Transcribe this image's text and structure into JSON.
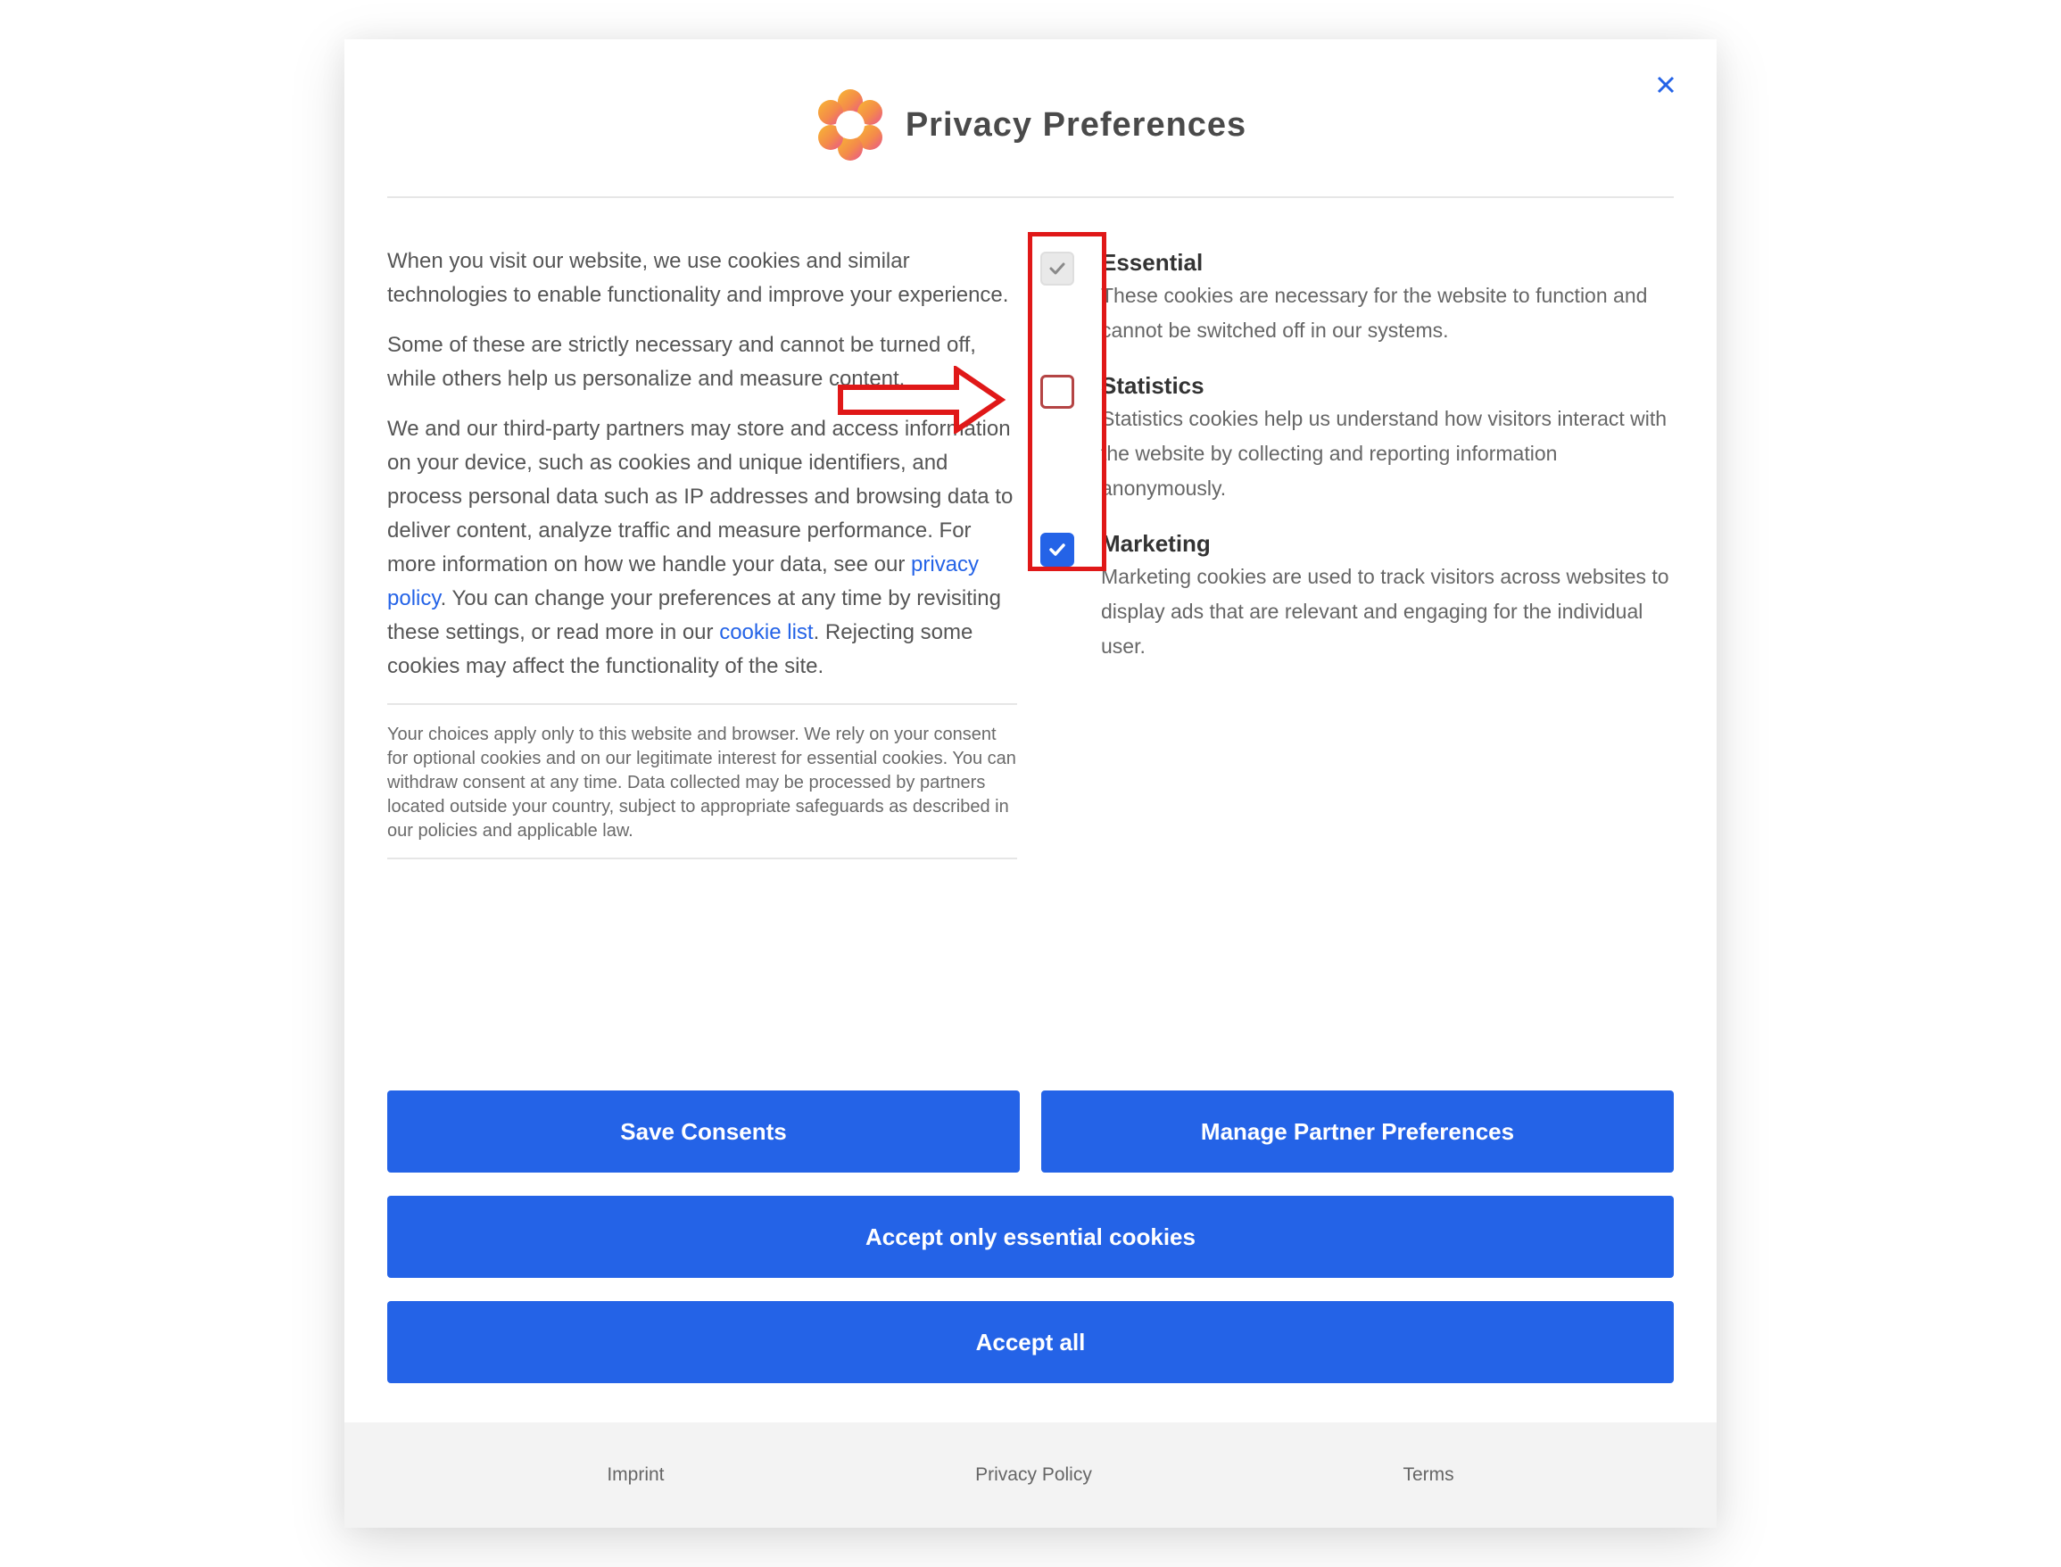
{
  "header": {
    "logo_icon": "flower-logo-icon",
    "title": "Privacy Preferences",
    "close_label": "×"
  },
  "intro": {
    "paragraph_1": "When you visit our website, we use cookies and similar technologies to enable functionality and improve your experience.",
    "paragraph_2": "Some of these are strictly necessary and cannot be turned off, while others help us personalize and measure content.",
    "paragraph_3_before_link": "We and our third-party partners may store and access information on your device, such as cookies and unique identifiers, and process personal data such as IP addresses and browsing data to deliver content, analyze traffic and measure performance. For more information on how we handle your data, see our",
    "privacy_link": "privacy policy",
    "paragraph_3_middle": ". You can change your preferences at any time by revisiting these settings, or read more in our",
    "cookie_link": "cookie list",
    "paragraph_3_after_link": ". Rejecting some cookies may affect the functionality of the site.",
    "small_print": "Your choices apply only to this website and browser. We rely on your consent for optional cookies and on our legitimate interest for essential cookies. You can withdraw consent at any time. Data collected may be processed by partners located outside your country, subject to appropriate safeguards as described in our policies and applicable law."
  },
  "categories": [
    {
      "title": "Essential",
      "description": "These cookies are necessary for the website to function and cannot be switched off in our systems.",
      "state": "disabled"
    },
    {
      "title": "Statistics",
      "description": "Statistics cookies help us understand how visitors interact with the website by collecting and reporting information anonymously.",
      "state": "unchecked"
    },
    {
      "title": "Marketing",
      "description": "Marketing cookies are used to track visitors across websites to display ads that are relevant and engaging for the individual user.",
      "state": "checked"
    }
  ],
  "buttons": {
    "save_consents": "Save Consents",
    "manage_partners": "Manage Partner Preferences",
    "accept_essential": "Accept only essential cookies",
    "accept_all": "Accept all"
  },
  "footer": {
    "link_1": "Imprint",
    "link_2": "Privacy Policy",
    "link_3": "Terms"
  },
  "colors": {
    "accent": "#2463e7",
    "annotation": "#e01818",
    "footer_bg": "#f3f3f3"
  }
}
